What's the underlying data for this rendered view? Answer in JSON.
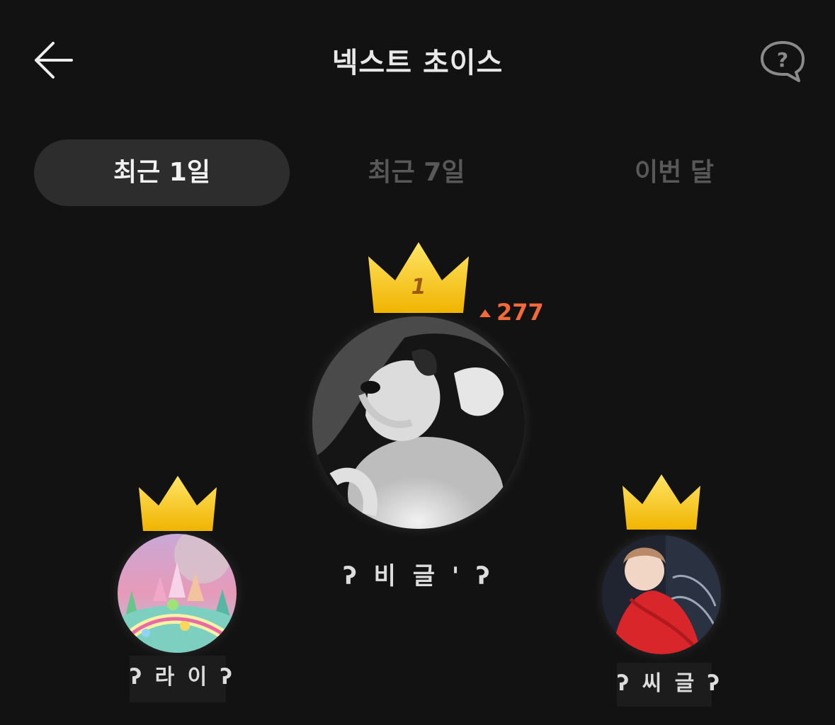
{
  "header": {
    "title": "넥스트 초이스",
    "back_icon": "arrow-left-icon",
    "help_icon": "question-bubble-icon"
  },
  "tabs": [
    {
      "label": "최근 1일",
      "active": true
    },
    {
      "label": "최근 7일",
      "active": false
    },
    {
      "label": "이번 달",
      "active": false
    }
  ],
  "ranking": {
    "first": {
      "rank_label": "1",
      "nickname": "ʔ 비 글 ' ʔ",
      "change": "277",
      "change_direction": "up"
    },
    "second": {
      "nickname": "ʔ 라 이 ʔ"
    },
    "third": {
      "nickname": "ʔ 씨 글  ʔ"
    }
  },
  "colors": {
    "background": "#121212",
    "tab_active_bg": "#2d2d2d",
    "crown_gold": "#f5c518",
    "change_up": "#f26a3a"
  }
}
